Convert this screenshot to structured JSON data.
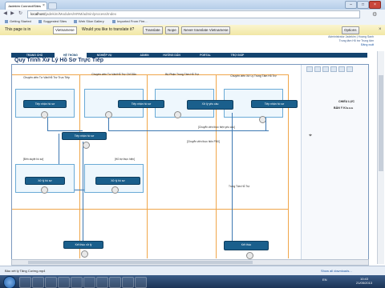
{
  "browser": {
    "tab_title": "Jadekim Connect/Sites",
    "tab_close": "×",
    "window_buttons": [
      "–",
      "□",
      "×"
    ],
    "url_host": "localhost",
    "url_path": "/jadekim/Modules/HRM/admin/process/Index",
    "menu_icon": "wrench-icon",
    "bookmarks": [
      "Getting Started",
      "Suggested Sites",
      "Web Slice Gallery",
      "Imported From Fire..."
    ],
    "translate": {
      "text_prefix": "This page is in",
      "language": "Vietnamese",
      "question": "Would you like to translate it?",
      "translate_btn": "Translate",
      "nope_btn": "Nope",
      "never_btn": "Never translate Vietnamese",
      "options": "Options",
      "close": "×"
    }
  },
  "app": {
    "brand_line1": "Administrator Jadekim | Hoang Sanh",
    "brand_line2": "Trung tâm Hỗ trợ Trung tâm",
    "brand_line3": "Đăng xuất",
    "nav": [
      "TRANG CHỦ",
      "HỆ THỐNG",
      "NGHIỆP VỤ",
      "ADMIN",
      "HƯỚNG DẪN",
      "PORTAL",
      "TRỢ GIÚP"
    ],
    "active_nav": 1,
    "page_title": "Quy Trình Xử Lý Hồ Sơ Trực Tiếp"
  },
  "diagram": {
    "lanes": [
      "Chuyên viên Tư Vấn/Hỗ Trợ Trực Tiếp",
      "Chuyên viên Tư Vấn/Hỗ Trợ Chỉ Dẫn",
      "Bộ Phận Trung Tâm Hỗ Trợ",
      "Chuyên viên Xử Lý Trung Tâm Hỗ Trợ"
    ],
    "nodes": [
      "Tiếp nhận hồ sơ",
      "Tiếp nhận hồ sơ",
      "Xử lý yêu cầu",
      "Tiếp nhận hồ sơ",
      "Tiếp nhận hồ sơ",
      "Xử lý hồ sơ",
      "Xử lý hồ sơ",
      "Kết thúc xử lý",
      "Kết thúc"
    ],
    "notes": [
      "[Chuyển viên thực hiện yêu cầu]",
      "[Chuyển viên thực hiện PBX]",
      "[Đến duyệt hồ sơ]",
      "[Hỗ trợ thực hiện]"
    ],
    "mid_label": "Trung Tâm Hỗ Trợ",
    "side_title": "CHIẾU LỰC",
    "side_value": "BẢN Ý KI ▸ ▸ ▸"
  },
  "downloads": {
    "item": "Bảo xét lý Tăng Cường.mp4",
    "show_all": "Show all downloads..."
  },
  "taskbar": {
    "tray": "EN",
    "time": "10:43",
    "date": "21/05/2013"
  },
  "colors": {
    "nav_bg": "#14446f",
    "node_bg": "#1a5f8c",
    "lane_line": "#f0a64a",
    "translate_bar": "#f4ebb2"
  }
}
